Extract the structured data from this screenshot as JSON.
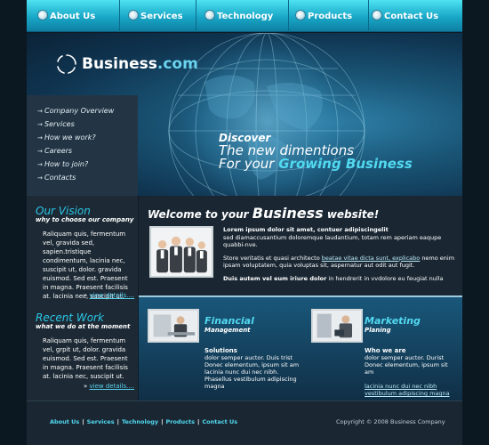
{
  "nav": {
    "items": [
      "About Us",
      "Services",
      "Technology",
      "Products",
      "Contact Us"
    ]
  },
  "logo": {
    "brand": "Business",
    "suffix": ".com"
  },
  "menu": {
    "items": [
      "Company Overview",
      "Services",
      "How we work?",
      "Careers",
      "How to join?",
      "Contacts"
    ]
  },
  "hero": {
    "line1": "Discover",
    "line2": "The new dimentions",
    "line3_prefix": "For your ",
    "line3_highlight": "Growing Business"
  },
  "vision": {
    "title": "Our Vision",
    "subtitle": "why to choose our company",
    "body": "Raliquam quis, fermentum vel, gravida sed, sapien.tristique condimentum, lacinia nec, suscipit ut, dolor. gravida euismod. Sed est. Praesent in magna. Praesent facilisis at. lacinia nec, suscipit ut.",
    "more_prefix": "» ",
    "more_link": "view details...."
  },
  "recent": {
    "title": "Recent Work",
    "subtitle": "what we do at the moment",
    "body": "Raliquam quis, fermentum vel, grpit ut, dolor. gravida euismod. Sed est. Praesent in magna. Praesent facilisis at. lacinia nec, suscipit ut.",
    "more_prefix": "» ",
    "more_link": "view details...."
  },
  "welcome": {
    "title_prefix": "Welcome to your ",
    "title_big": "Business",
    "title_suffix": " website!",
    "p1_bold": "Lorem ipsum dolor sit amet, contuer adipiscingelit",
    "p1": "sed diamaccusantium doloremque laudantium, totam rem aperiam eaqupe quabbi-nve.",
    "p2a": "Store veritatis et quasi architecto ",
    "p2_link": "beatae vitae dicta sunt, explicabo",
    "p2b": " nemo enim ipsam voluptatem, quia voluptas sit, aspernatur aut odit aut fugit.",
    "p3_bold": "Duis autem vel eum iriure dolor",
    "p3": " in hendrerit in vvdolore eu feugiat nulla"
  },
  "financial": {
    "title": "Financial",
    "subtitle": "Management",
    "head": "Solutions",
    "body": "dolor semper auctor. Duis trist Donec elementum, ipsum sit am lacinia nunc dui nec nibh. Phasellus vestibulum adipiscing magna"
  },
  "marketing": {
    "title": "Marketing",
    "subtitle": "Planing",
    "head": "Who we are",
    "body": "dolor semper auctor. Durist Donec elementum, ipsum sit am",
    "link": "lacinia nunc dui nec nibh vestibulum adipiscing magna"
  },
  "footer": {
    "links": [
      "About Us",
      "Services",
      "Technology",
      "Products",
      "Contact Us"
    ],
    "separator": "|",
    "copyright": "Copyright © 2008 Business Company"
  },
  "colors": {
    "accent": "#52d9f0",
    "nav_top": "#4ee2f2",
    "panel": "#1a2733"
  }
}
